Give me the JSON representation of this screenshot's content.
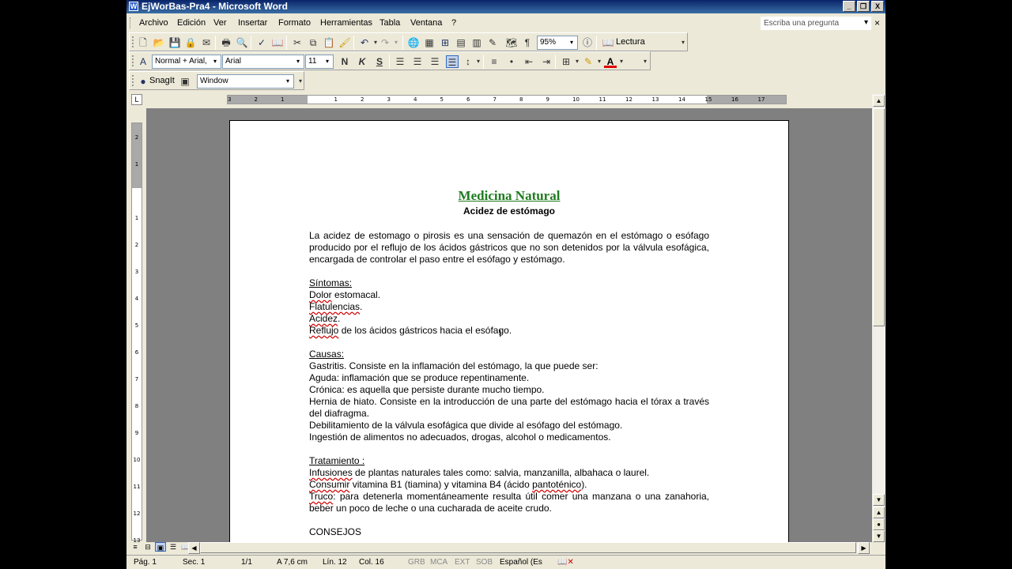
{
  "window": {
    "title": "EjWorBas-Pra4 - Microsoft Word",
    "title_icon": "W"
  },
  "title_buttons": {
    "minimize": "_",
    "maximize": "❐",
    "close": "X"
  },
  "menu": {
    "items": [
      "Archivo",
      "Edición",
      "Ver",
      "Insertar",
      "Formato",
      "Herramientas",
      "Tabla",
      "Ventana",
      "?"
    ],
    "help_placeholder": "Escriba una pregunta",
    "close_doc": "×"
  },
  "standard_toolbar": {
    "zoom": "95%",
    "reading": "Lectura"
  },
  "format_toolbar": {
    "style": "Normal + Arial,",
    "font": "Arial",
    "size": "11",
    "bold": "N",
    "italic": "K",
    "underline": "S",
    "font_color_glyph": "A"
  },
  "snagit_toolbar": {
    "snagit_label": "SnagIt",
    "capture_mode": "Window"
  },
  "ruler": {
    "corner": "L",
    "h_ticks": [
      "3",
      "2",
      "1",
      "1",
      "2",
      "3",
      "4",
      "5",
      "6",
      "7",
      "8",
      "9",
      "10",
      "11",
      "12",
      "13",
      "14",
      "15",
      "16",
      "17"
    ],
    "v_ticks": [
      "2",
      "1",
      "1",
      "2",
      "3",
      "4",
      "5",
      "6",
      "7",
      "8",
      "9",
      "10",
      "11",
      "12",
      "13"
    ]
  },
  "document": {
    "title": "Medicina Natural",
    "subtitle": "Acidez de estómago",
    "intro": "La acidez de estomago o pirosis es una sensación de quemazón en el estómago o esófago producido por el reflujo de los ácidos gástricos que no son detenidos por la válvula esofágica, encargada de controlar el paso entre el esófago y estómago.",
    "sintomas_heading": "Síntomas:",
    "sintomas": [
      {
        "w": "Dolor",
        "rest": " estomacal."
      },
      {
        "w": "Flatulencias",
        "rest": "."
      },
      {
        "w": "Acidez",
        "rest": "."
      },
      {
        "w": "Reflujo",
        "rest": " de los ácidos gástricos hacia el esófago."
      }
    ],
    "causas_heading": "Causas:",
    "causas": [
      "Gastritis. Consiste en la inflamación del estómago, la que puede ser:",
      "Aguda: inflamación que se produce repentinamente.",
      "Crónica: es aquella que persiste durante mucho tiempo.",
      "Hernia de hiato. Consiste en la introducción de una parte del estómago hacia el tórax a través del diafragma.",
      "Debilitamiento de la válvula esofágica que divide al esófago del estómago.",
      "Ingestión de alimentos no adecuados, drogas, alcohol o medicamentos."
    ],
    "tratamiento_heading": "Tratamiento :",
    "tratamiento": {
      "t1_w": "Infusiones",
      "t1_rest": " de plantas naturales tales como: salvia, manzanilla, albahaca o laurel.",
      "t2_w": "Consumir",
      "t2_mid": " vitamina B1 (tiamina) y vitamina B4 (ácido ",
      "t2_w2": "pantoténico",
      "t2_end": ").",
      "t3_w": "Truco",
      "t3_rest": ": para detenerla momentáneamente resulta útil comer una manzana o una zanahoria, beber un poco de leche o una cucharada de aceite crudo."
    },
    "consejos_heading": "CONSEJOS"
  },
  "status": {
    "page": "Pág. 1",
    "section": "Sec. 1",
    "pages": "1/1",
    "at": "A  7,6 cm",
    "line": "Lín. 12",
    "col": "Col. 16",
    "rec": "GRB",
    "trk": "MCA",
    "ext": "EXT",
    "ovr": "SOB",
    "language": "Español (Es"
  }
}
